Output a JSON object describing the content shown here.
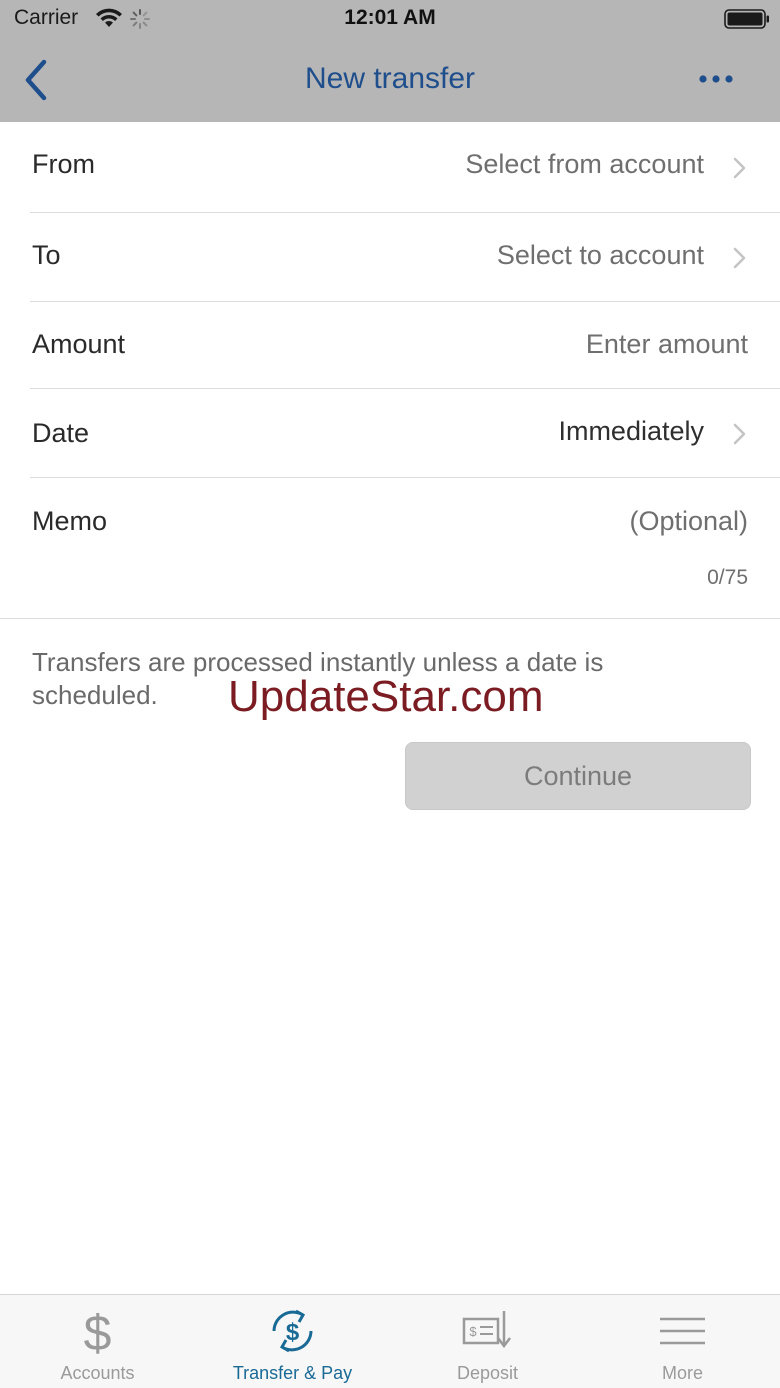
{
  "status_bar": {
    "carrier": "Carrier",
    "time": "12:01 AM"
  },
  "nav": {
    "title": "New transfer",
    "back_icon": "chevron-left-icon",
    "more_icon": "ellipsis-icon"
  },
  "form": {
    "from": {
      "label": "From",
      "value": "Select from account"
    },
    "to": {
      "label": "To",
      "value": "Select to account"
    },
    "amount": {
      "label": "Amount",
      "placeholder": "Enter amount"
    },
    "date": {
      "label": "Date",
      "value": "Immediately"
    },
    "memo": {
      "label": "Memo",
      "placeholder": "(Optional)",
      "counter": "0/75"
    }
  },
  "note": "Transfers are processed instantly unless a date is scheduled.",
  "watermark": "UpdateStar.com",
  "continue_label": "Continue",
  "tabs": [
    {
      "label": "Accounts",
      "icon": "dollar-icon",
      "active": false
    },
    {
      "label": "Transfer & Pay",
      "icon": "transfer-pay-icon",
      "active": true
    },
    {
      "label": "Deposit",
      "icon": "check-deposit-icon",
      "active": false
    },
    {
      "label": "More",
      "icon": "menu-icon",
      "active": false
    }
  ],
  "colors": {
    "nav_bg": "#b6b6b6",
    "nav_title": "#1f4e8c",
    "active_tab": "#1a6a96",
    "inactive_tab": "#9a9a9a",
    "watermark": "#7b1c22"
  }
}
